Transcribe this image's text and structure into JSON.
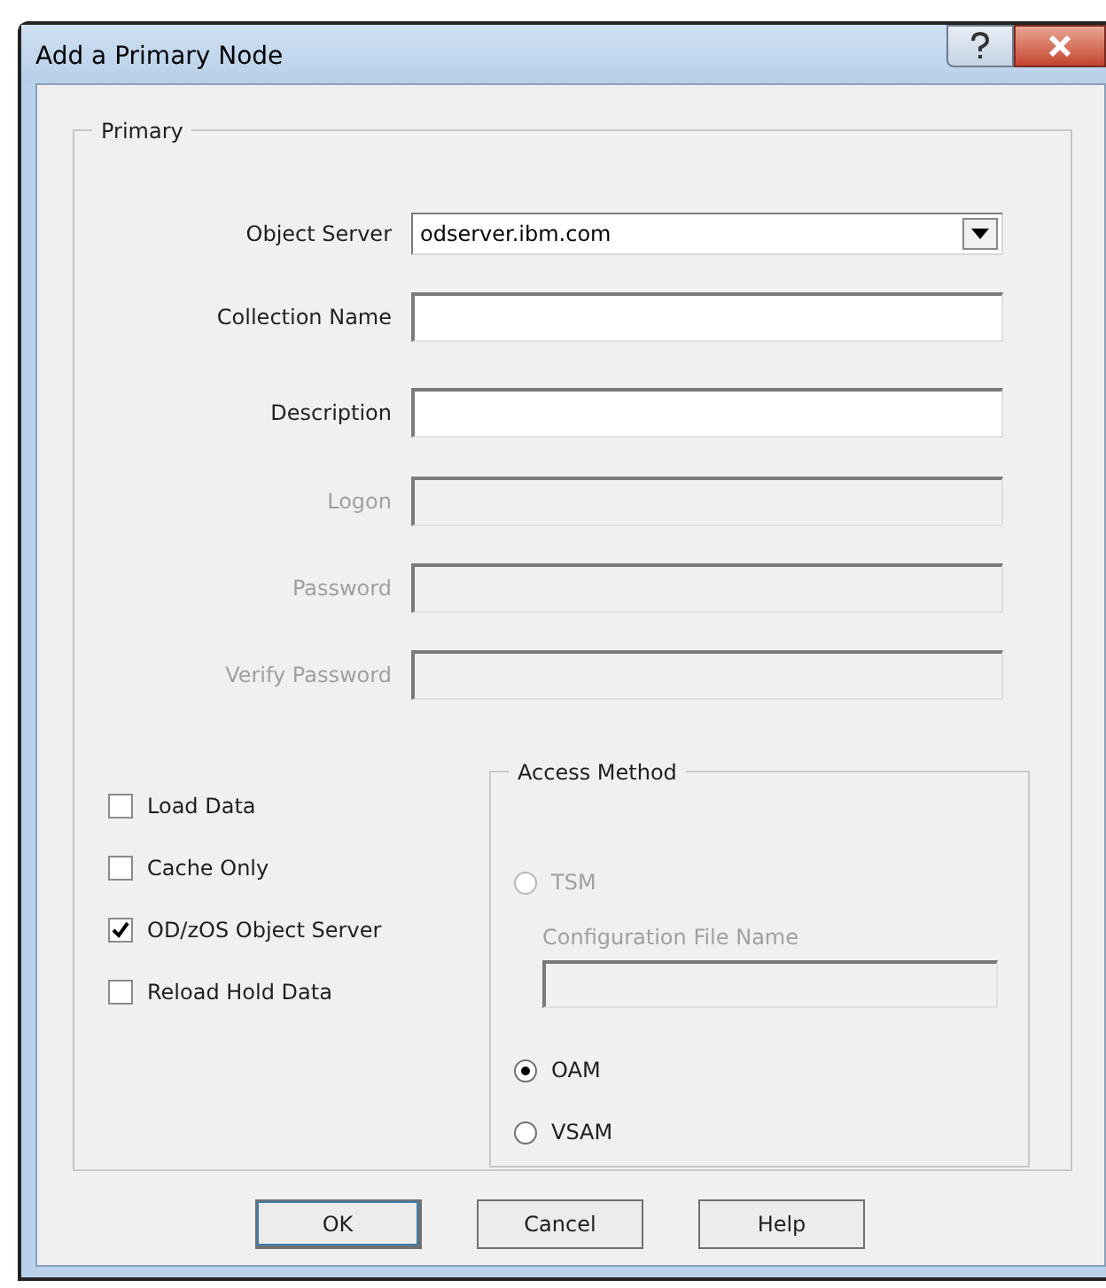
{
  "window": {
    "title": "Add a Primary Node"
  },
  "primary": {
    "title": "Primary",
    "fields": [
      {
        "kind": "dropdown",
        "label": "Object Server",
        "value": "odserver.ibm.com",
        "disabled": false
      },
      {
        "kind": "text",
        "label": "Collection Name",
        "disabled": false
      },
      {
        "kind": "text",
        "label": "Description",
        "disabled": false
      },
      {
        "kind": "text",
        "label": "Logon",
        "disabled": true
      },
      {
        "kind": "text",
        "label": "Password",
        "disabled": true
      },
      {
        "kind": "text",
        "label": "Verify Password",
        "disabled": true
      }
    ],
    "checkboxes": [
      {
        "label": "Load Data",
        "checked": false
      },
      {
        "label": "Cache Only",
        "checked": false
      },
      {
        "label": "OD/zOS Object Server",
        "checked": true
      },
      {
        "label": "Reload Hold Data",
        "checked": false
      }
    ],
    "access_method": {
      "title": "Access Method",
      "items": [
        {
          "kind": "radio",
          "label": "TSM",
          "selected": false,
          "disabled": true
        },
        {
          "kind": "field",
          "label": "Configuration File Name",
          "disabled": true
        },
        {
          "kind": "radio",
          "label": "OAM",
          "selected": true,
          "disabled": false
        },
        {
          "kind": "radio",
          "label": "VSAM",
          "selected": false,
          "disabled": false
        }
      ]
    }
  },
  "buttons": [
    {
      "label": "OK",
      "default": true
    },
    {
      "label": "Cancel",
      "default": false
    },
    {
      "label": "Help",
      "default": false
    }
  ]
}
